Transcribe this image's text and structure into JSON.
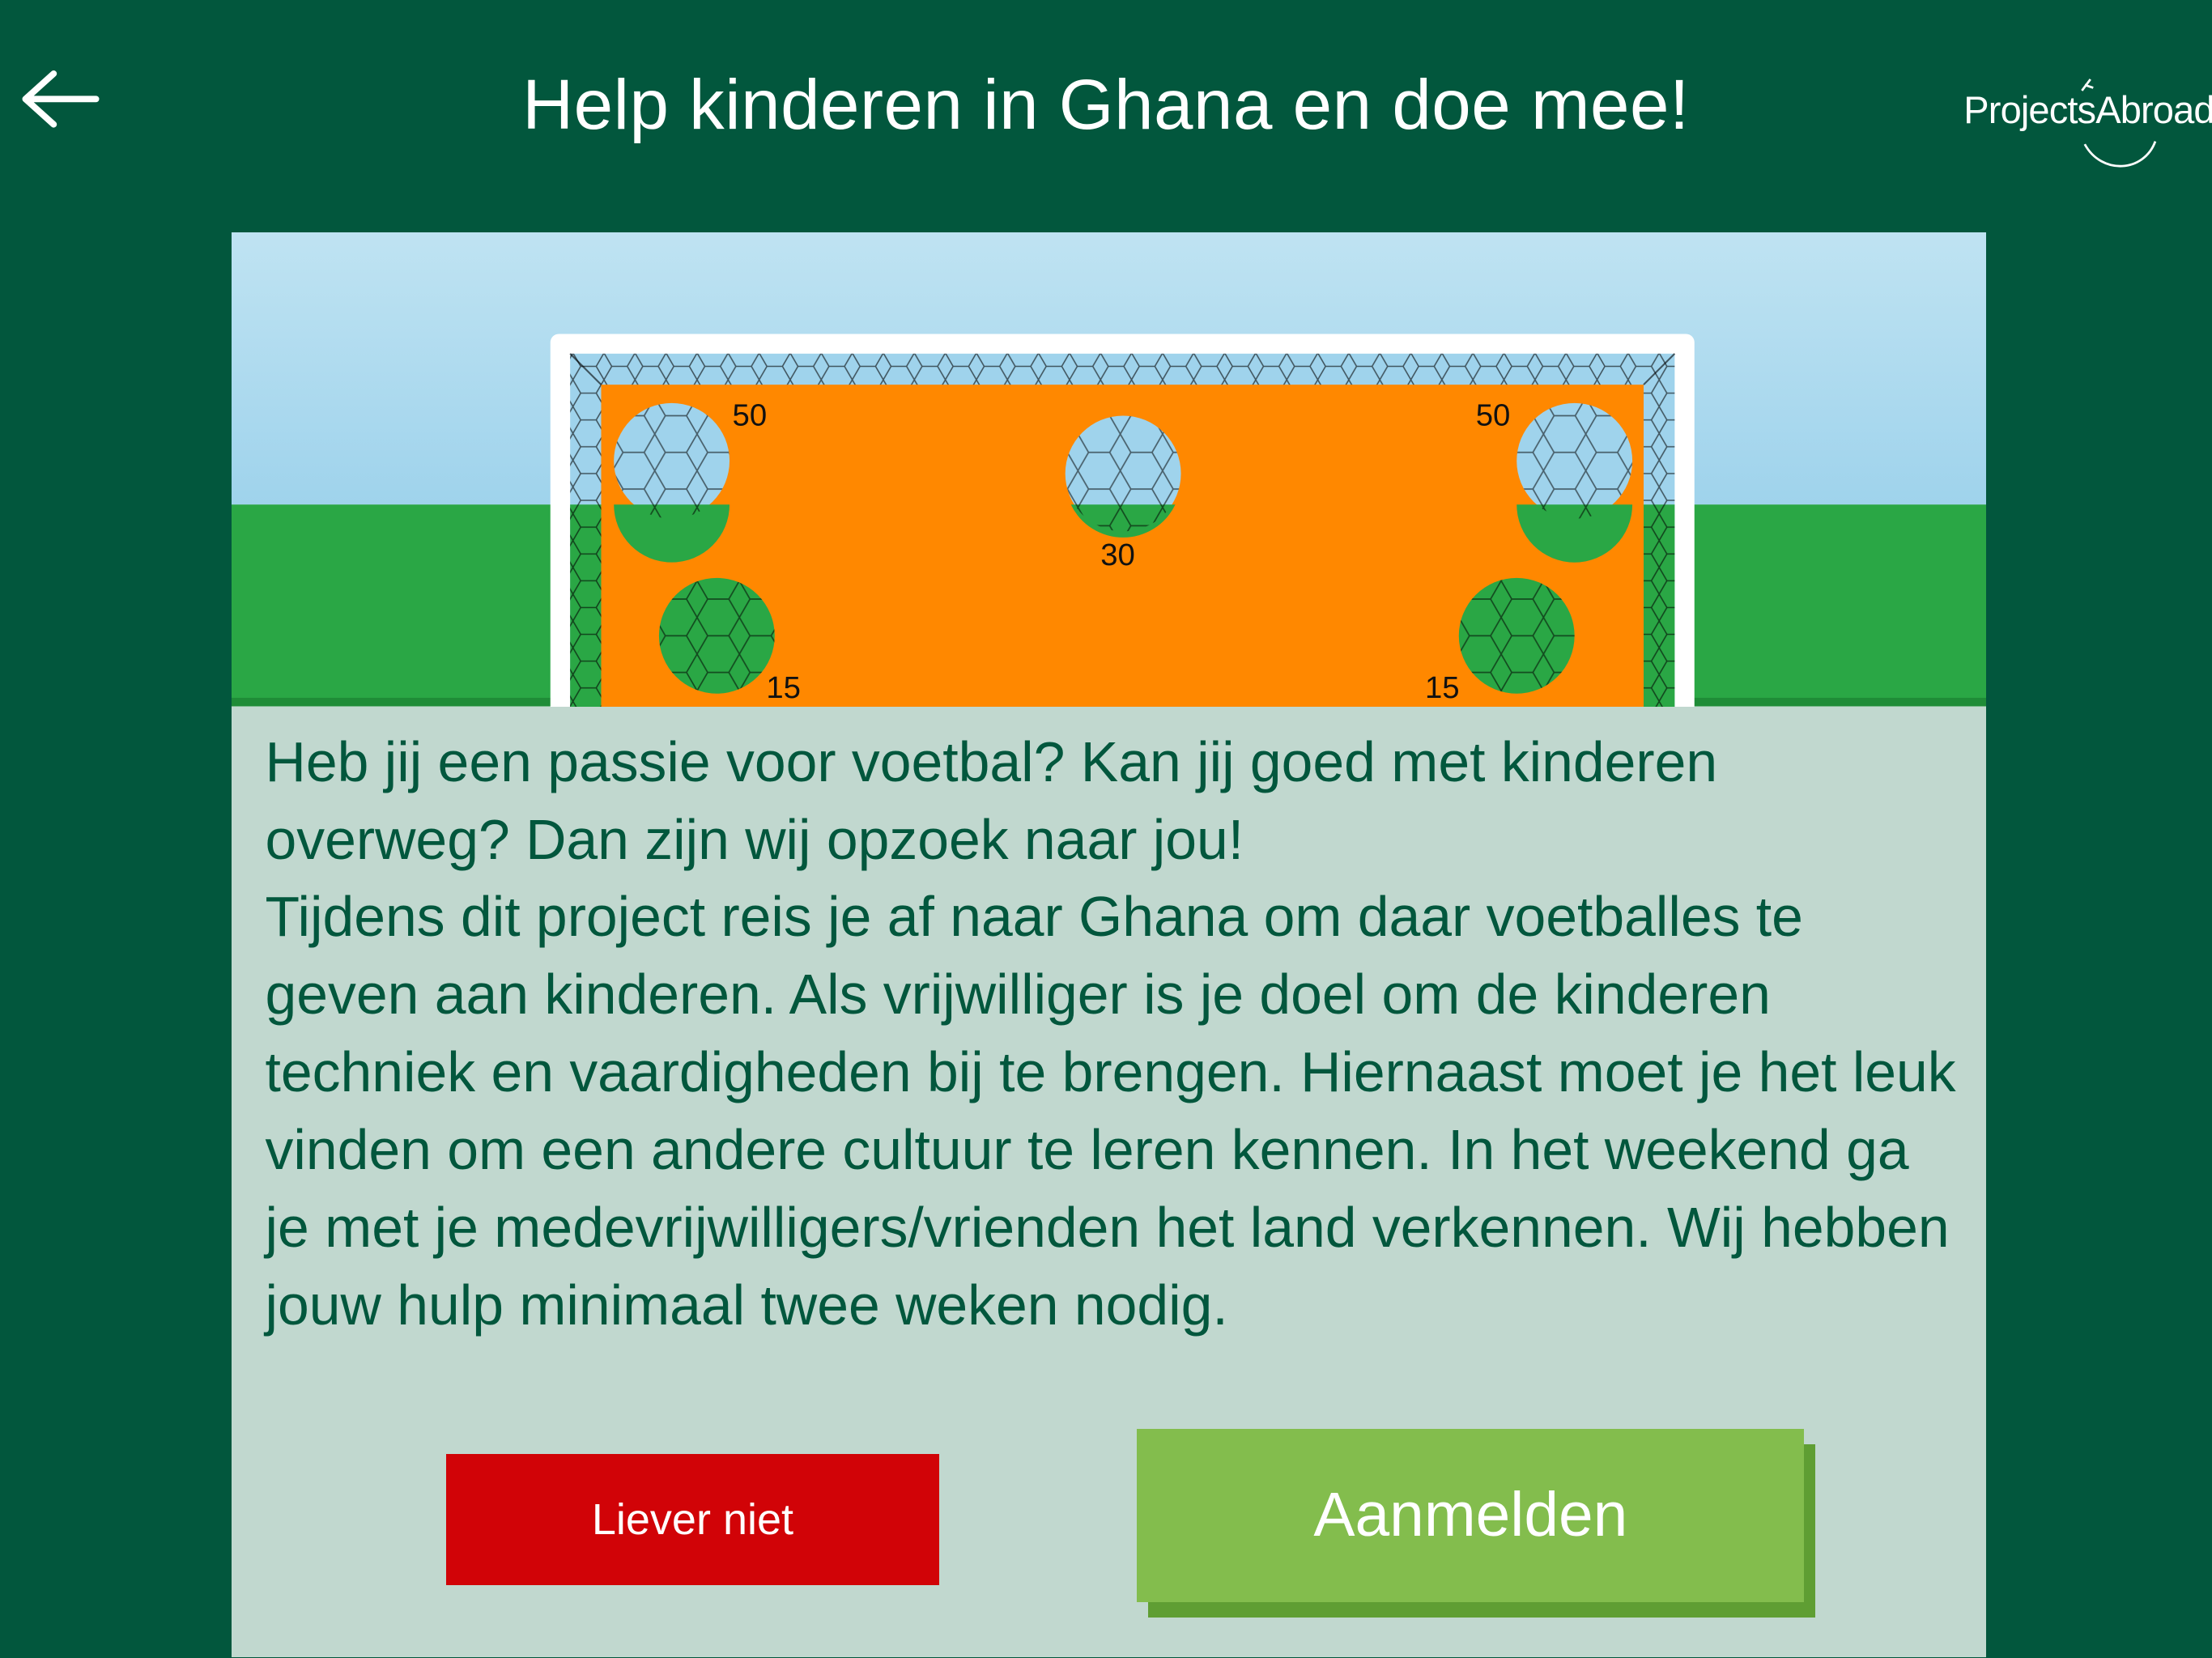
{
  "header": {
    "title": "Help kinderen in Ghana en doe mee!",
    "back_icon": "left-arrow-icon",
    "logo_text": "ProjectsAbroad"
  },
  "game": {
    "targets": [
      {
        "points": "50",
        "ground": "sky"
      },
      {
        "points": "30",
        "ground": "sky"
      },
      {
        "points": "50",
        "ground": "sky"
      },
      {
        "points": "15",
        "ground": "grass"
      },
      {
        "points": "15",
        "ground": "grass"
      }
    ]
  },
  "description": {
    "paragraph": "Heb jij een passie voor voetbal? Kan jij goed met kinderen overweg? Dan zijn wij opzoek naar jou!\nTijdens dit project reis je af naar Ghana om daar voetballes te geven aan kinderen. Als vrijwilliger is je doel om de kinderen techniek en vaardigheden bij te brengen. Hiernaast moet je het leuk vinden om een andere cultuur te leren kennen. In het weekend ga je met je medevrijwilligers/vrienden het land verkennen. Wij hebben jouw hulp minimaal twee weken nodig."
  },
  "buttons": {
    "decline_label": "Liever niet",
    "signup_label": "Aanmelden"
  },
  "colors": {
    "background": "#02573d",
    "panel": "#c1d8cf",
    "sky_top": "#bfe3f2",
    "sky_bottom": "#9fd3ec",
    "grass": "#2aa745",
    "board": "#ff8800",
    "decline": "#d10307",
    "signup": "#83bd4d"
  }
}
